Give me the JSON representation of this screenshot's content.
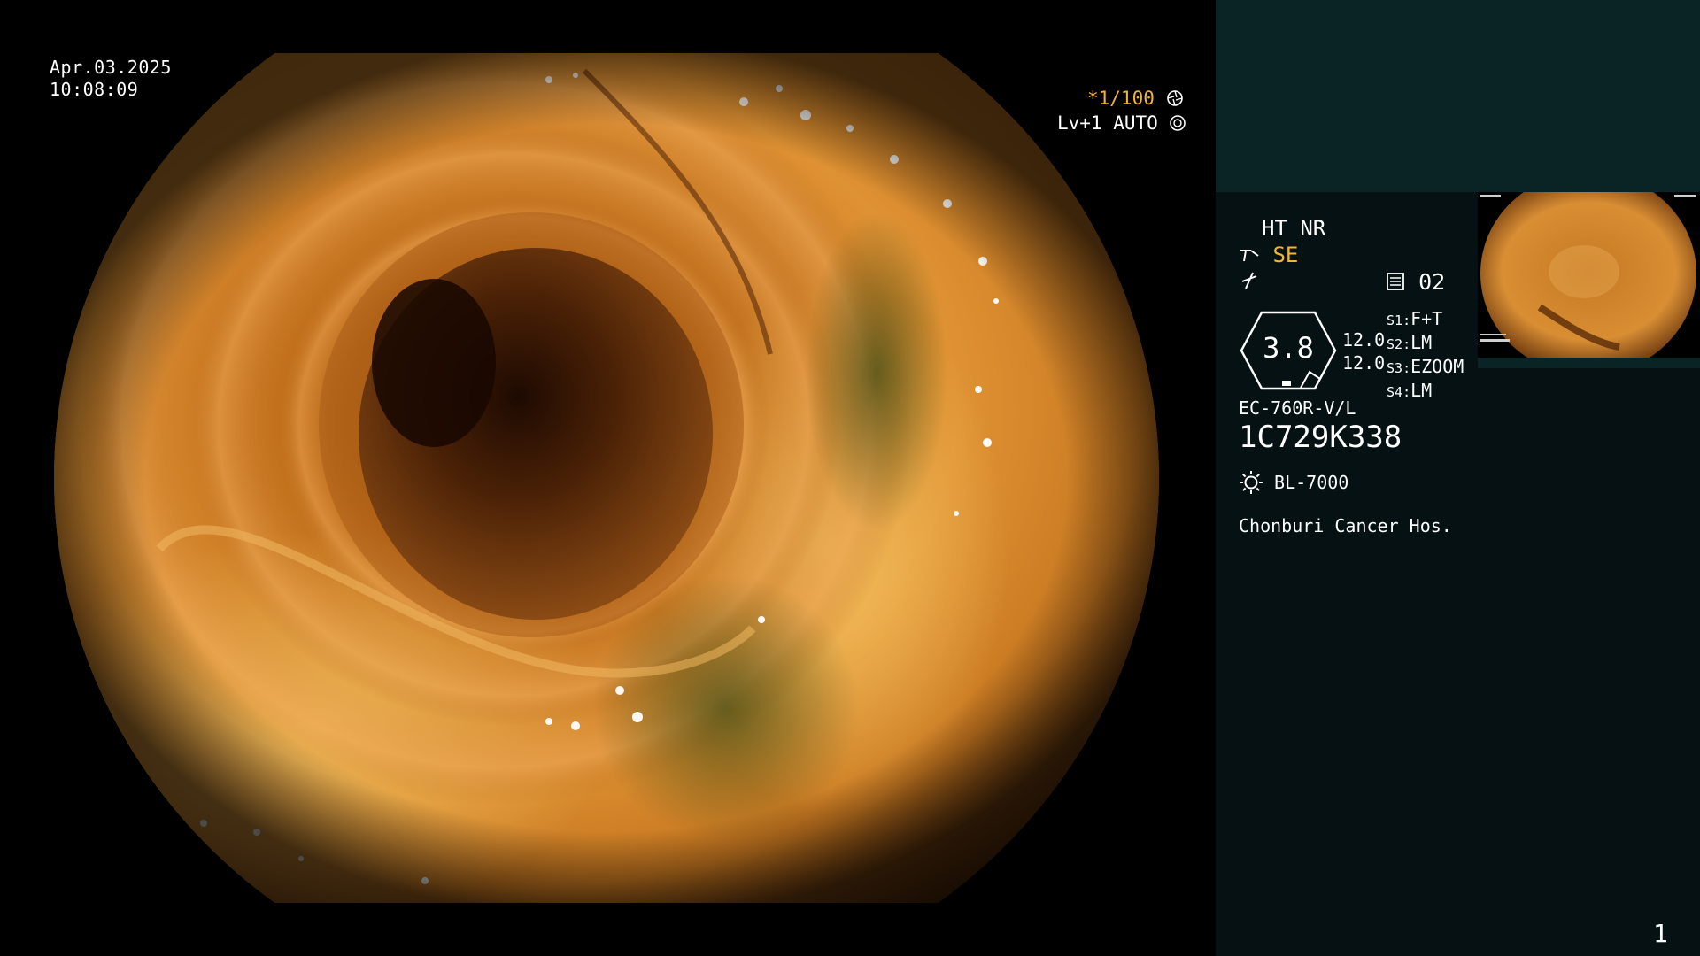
{
  "overlay": {
    "date": "Apr.03.2025",
    "time": "10:08:09",
    "shutter": "*1/100",
    "level_mode": "Lv+1 AUTO",
    "shutter_icon": "aperture-icon",
    "auto_icon": "iris-icon"
  },
  "panel": {
    "ht_nr": "HT NR",
    "se_label": "SE",
    "se_icon": "structure-enhance-icon",
    "color_icon": "color-mode-icon",
    "memory_icon": "memory-card-icon",
    "memory_count": "02",
    "gauge_value": "3.8",
    "gauge_top": "12.0",
    "gauge_bottom": "12.0",
    "switches": [
      {
        "key": "S1",
        "value": "F+T"
      },
      {
        "key": "S2",
        "value": "LM"
      },
      {
        "key": "S3",
        "value": "EZOOM"
      },
      {
        "key": "S4",
        "value": "LM"
      }
    ],
    "scope_model": "EC-760R-V/L",
    "scope_serial": "1C729K338",
    "light_icon": "light-source-icon",
    "light_source": "BL-7000",
    "hospital": "Chonburi Cancer Hos.",
    "page_number": "1"
  },
  "colors": {
    "accent": "#f2b531",
    "panel_bg": "#051112",
    "panel_top_bg": "#0a2426",
    "tissue": "#d9851e"
  }
}
